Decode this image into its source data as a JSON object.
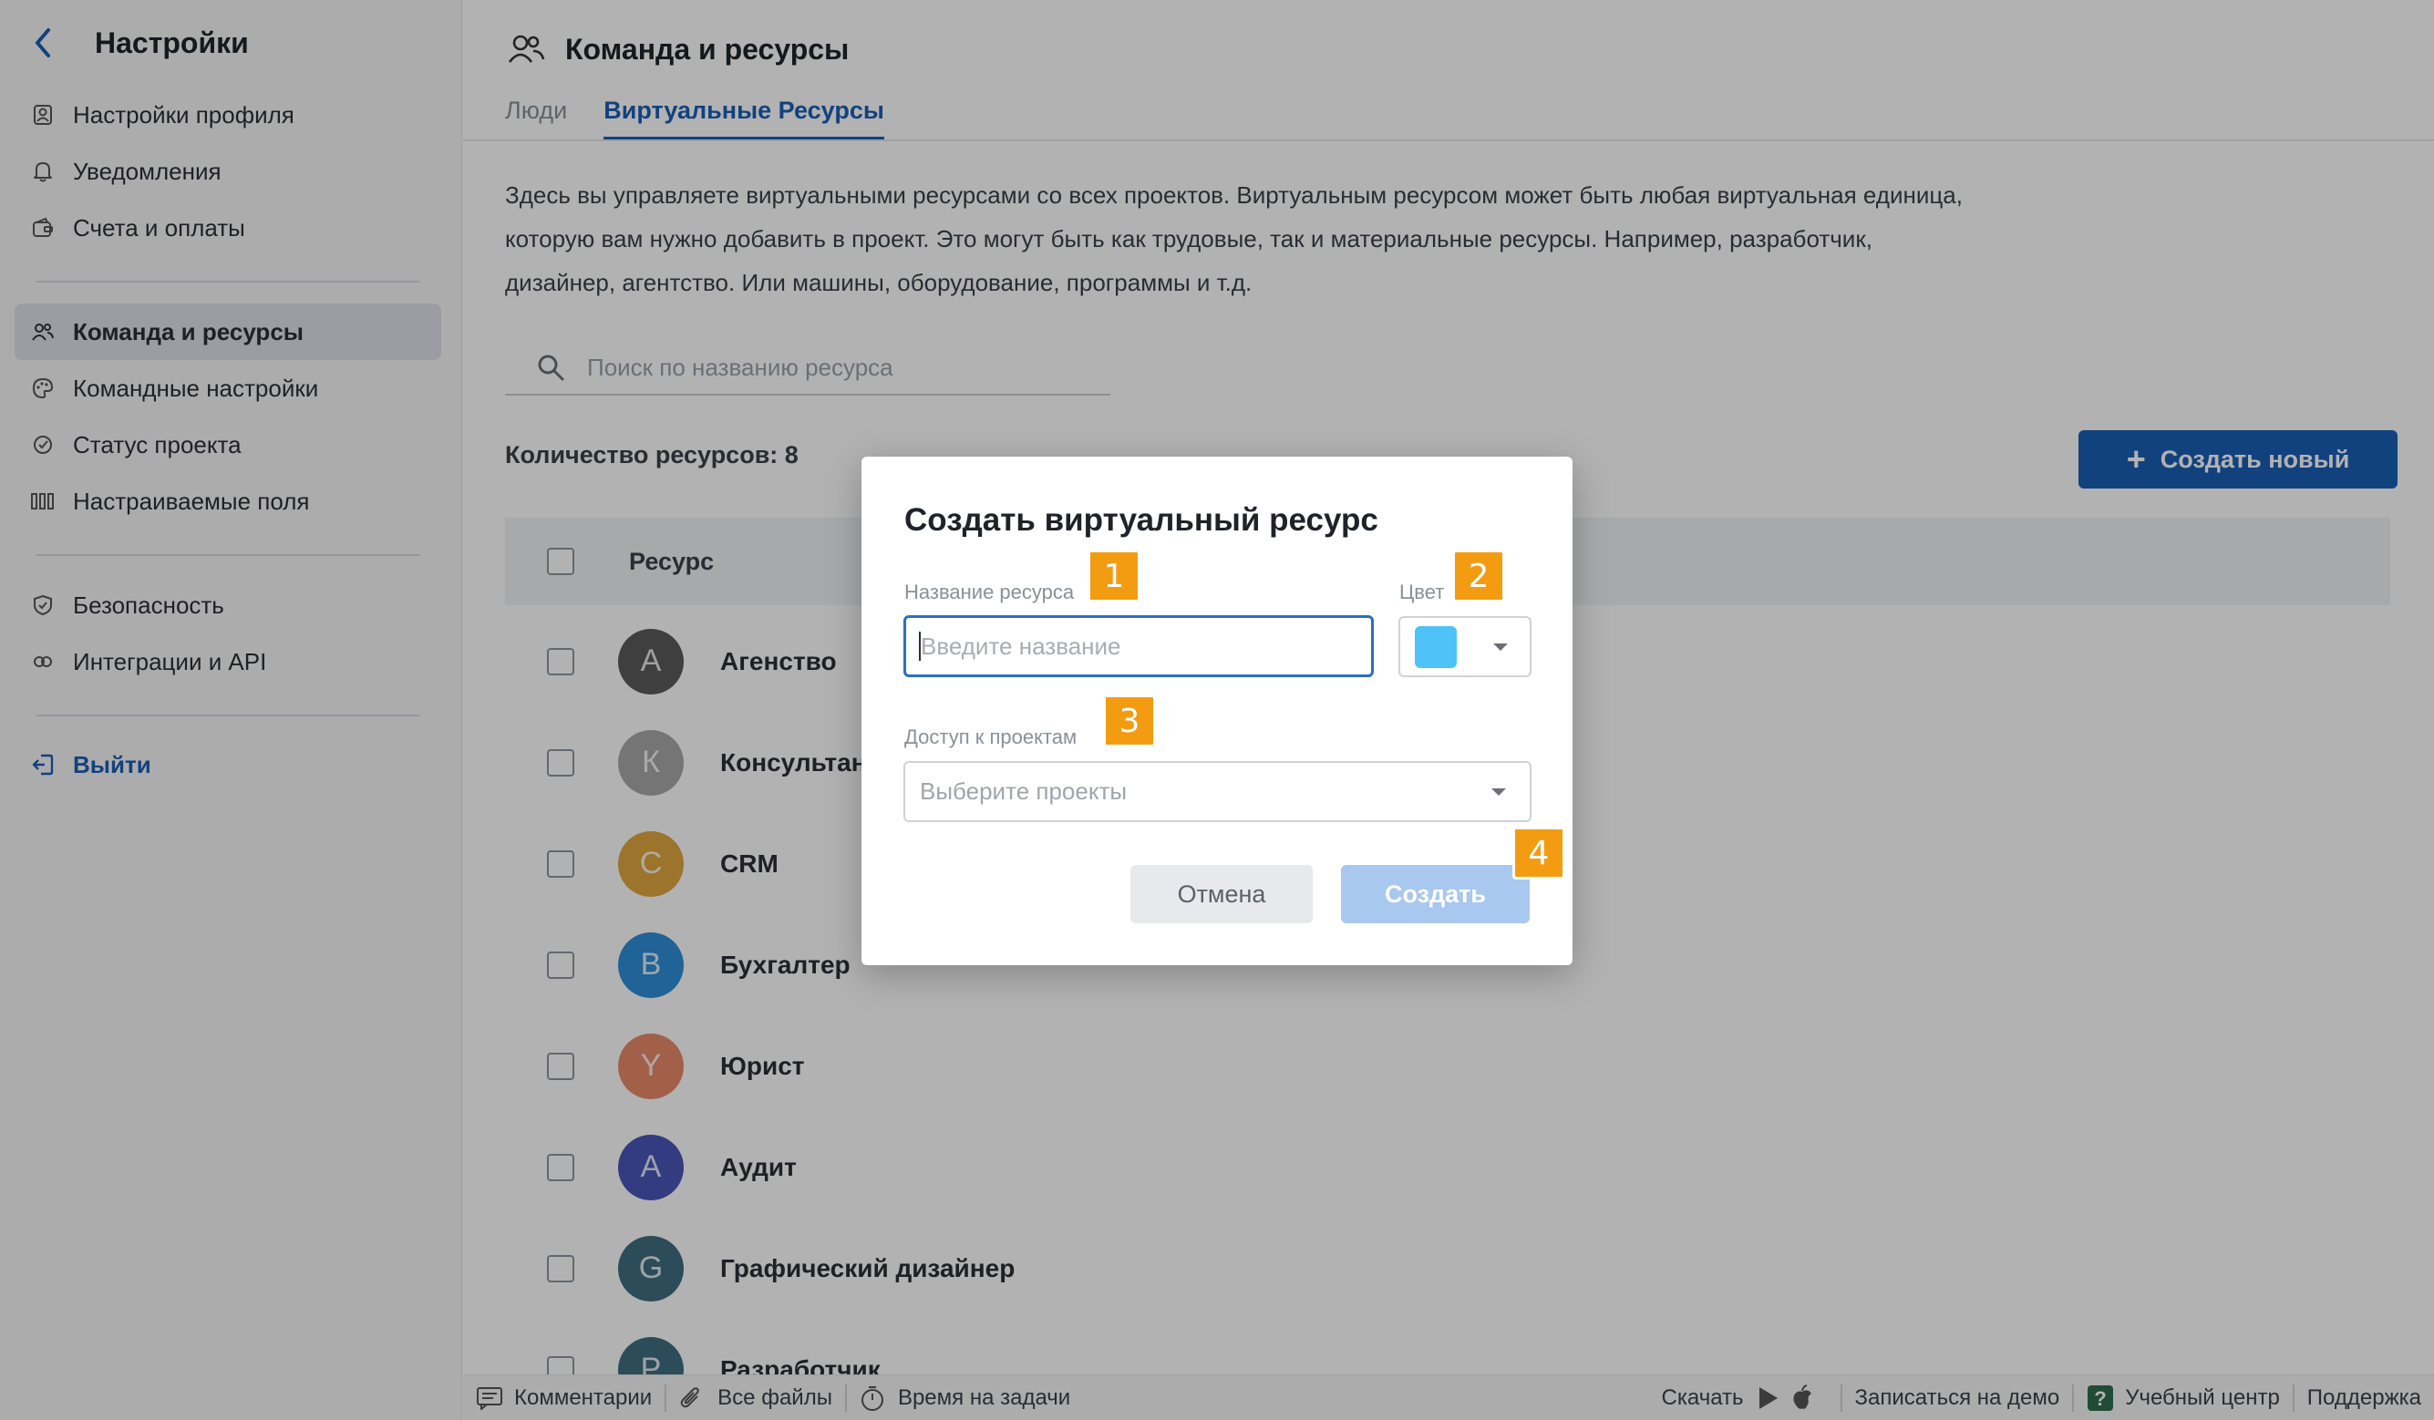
{
  "sidebar": {
    "title": "Настройки",
    "group1": [
      {
        "label": "Настройки профиля",
        "icon": "profile-icon"
      },
      {
        "label": "Уведомления",
        "icon": "bell-icon"
      },
      {
        "label": "Счета и оплаты",
        "icon": "wallet-icon"
      }
    ],
    "group2": [
      {
        "label": "Команда и ресурсы",
        "icon": "team-icon",
        "active": true
      },
      {
        "label": "Командные настройки",
        "icon": "palette-icon"
      },
      {
        "label": "Статус проекта",
        "icon": "status-icon"
      },
      {
        "label": "Настраиваемые поля",
        "icon": "columns-icon"
      }
    ],
    "group3": [
      {
        "label": "Безопасность",
        "icon": "shield-icon"
      },
      {
        "label": "Интеграции и API",
        "icon": "integration-icon"
      }
    ],
    "logout": "Выйти"
  },
  "header": {
    "title": "Команда и ресурсы",
    "tabs": [
      "Люди",
      "Виртуальные Ресурсы"
    ],
    "active_tab": 1
  },
  "main": {
    "description": "Здесь вы управляете виртуальными ресурсами со всех проектов. Виртуальным ресурсом может быть любая виртуальная единица, которую вам нужно добавить в проект. Это могут быть как трудовые, так и материальные ресурсы. Например, разработчик, дизайнер, агентство. Или машины, оборудование, программы и т.д.",
    "search_placeholder": "Поиск по названию ресурса",
    "count_label": "Количество ресурсов: 8",
    "create_button": "Создать новый",
    "column_header": "Ресурс",
    "resources": [
      {
        "initial": "А",
        "name": "Агенство",
        "color": "#5b5b5b"
      },
      {
        "initial": "К",
        "name": "Консультант",
        "color": "#a8a8a8"
      },
      {
        "initial": "С",
        "name": "CRM",
        "color": "#e0a63e"
      },
      {
        "initial": "В",
        "name": "Бухгалтер",
        "color": "#2e8fd8"
      },
      {
        "initial": "Y",
        "name": "Юрист",
        "color": "#e88a6c"
      },
      {
        "initial": "А",
        "name": "Аудит",
        "color": "#4a56b8"
      },
      {
        "initial": "G",
        "name": "Графический дизайнер",
        "color": "#3e6e7e"
      },
      {
        "initial": "Р",
        "name": "Разработчик",
        "color": "#3e6e7e"
      }
    ]
  },
  "footer": {
    "comments": "Комментарии",
    "files": "Все файлы",
    "time": "Время на задачи",
    "download": "Скачать",
    "demo": "Записаться на демо",
    "learning": "Учебный центр",
    "support": "Поддержка"
  },
  "modal": {
    "title": "Создать виртуальный ресурс",
    "name_label": "Название ресурса",
    "name_placeholder": "Введите название",
    "color_label": "Цвет",
    "color_value": "#4fc3f7",
    "access_label": "Доступ к проектам",
    "access_placeholder": "Выберите проекты",
    "cancel": "Отмена",
    "submit": "Создать"
  },
  "badges": [
    "1",
    "2",
    "3",
    "4"
  ]
}
